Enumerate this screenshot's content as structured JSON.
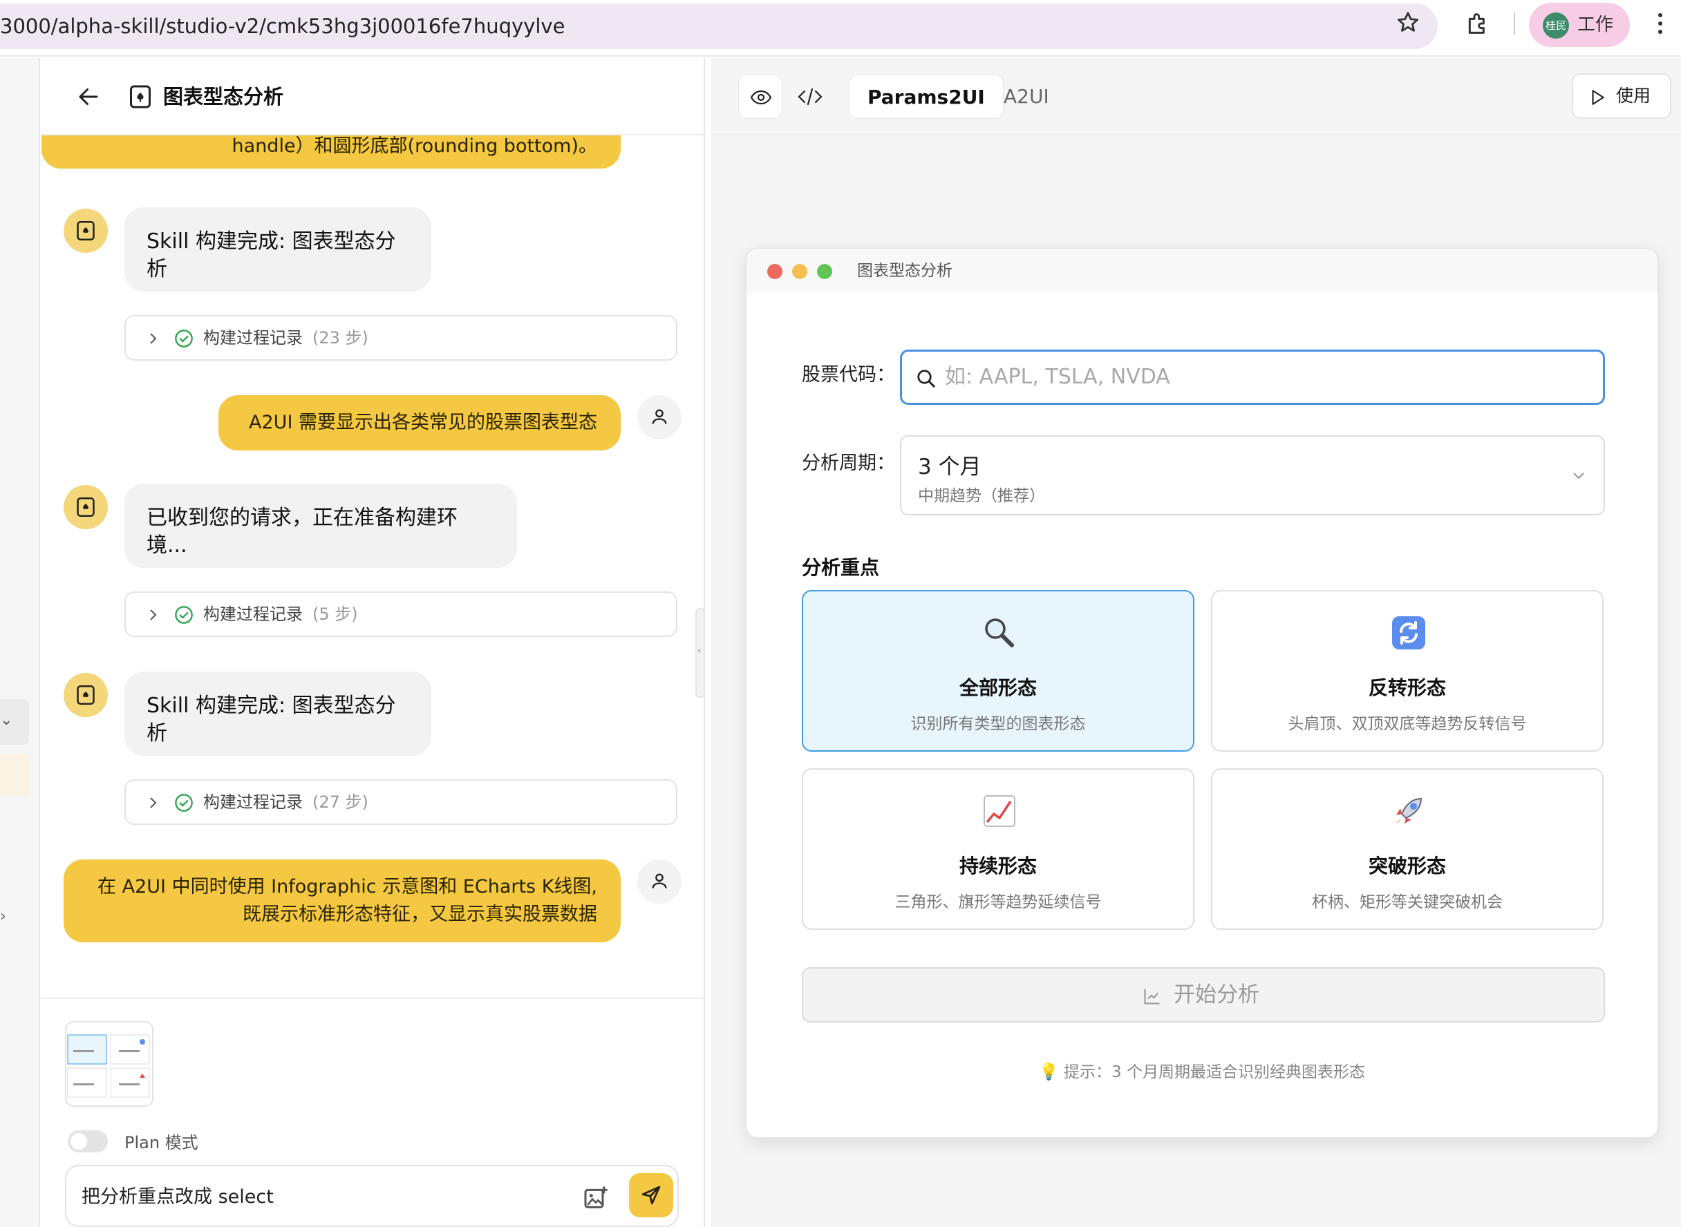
{
  "browser": {
    "url": "3000/alpha-skill/studio-v2/cmk53hg3j00016fe7huqyylve",
    "profile_avatar_text": "桂民",
    "profile_label": "工作"
  },
  "chat": {
    "title": "图表型态分析",
    "messages": {
      "m0": "handle）和圆形底部(rounding bottom)。",
      "m1": "Skill 构建完成: 图表型态分析",
      "log1": {
        "label": "构建过程记录",
        "count": "(23 步)"
      },
      "m2": "A2UI 需要显示出各类常见的股票图表型态",
      "m3": "已收到您的请求，正在准备构建环境...",
      "log2": {
        "label": "构建过程记录",
        "count": "(5 步)"
      },
      "m4": "Skill 构建完成: 图表型态分析",
      "log3": {
        "label": "构建过程记录",
        "count": "(27 步)"
      },
      "m5_line1": "在 A2UI 中同时使用 Infographic 示意图和 ECharts K线图,",
      "m5_line2": "既展示标准形态特征，又显示真实股票数据"
    },
    "composer": {
      "plan_label": "Plan 模式",
      "plan_enabled": false,
      "input_value": "把分析重点改成 select"
    }
  },
  "preview": {
    "tabs": [
      "Params2UI",
      "A2UI"
    ],
    "active_tab": "Params2UI",
    "use_label": "使用",
    "window": {
      "title": "图表型态分析",
      "stock_label": "股票代码：",
      "stock_placeholder": "如: AAPL, TSLA, NVDA",
      "period_label": "分析周期：",
      "period_value": "3 个月",
      "period_sub": "中期趋势（推荐）",
      "focus_label": "分析重点",
      "cards": [
        {
          "title": "全部形态",
          "desc": "识别所有类型的图表形态",
          "icon": "magnifier-icon",
          "selected": true
        },
        {
          "title": "反转形态",
          "desc": "头肩顶、双顶双底等趋势反转信号",
          "icon": "cycle-arrows-icon",
          "selected": false
        },
        {
          "title": "持续形态",
          "desc": "三角形、旗形等趋势延续信号",
          "icon": "trend-chart-icon",
          "selected": false
        },
        {
          "title": "突破形态",
          "desc": "杯柄、矩形等关键突破机会",
          "icon": "rocket-icon",
          "selected": false
        }
      ],
      "start_label": "开始分析",
      "hint": "💡 提示：3 个月周期最适合识别经典图表形态"
    }
  },
  "colors": {
    "accent_yellow": "#f4c842",
    "selected_blue": "#3e9de6",
    "selected_bg": "#e8f5fd"
  }
}
